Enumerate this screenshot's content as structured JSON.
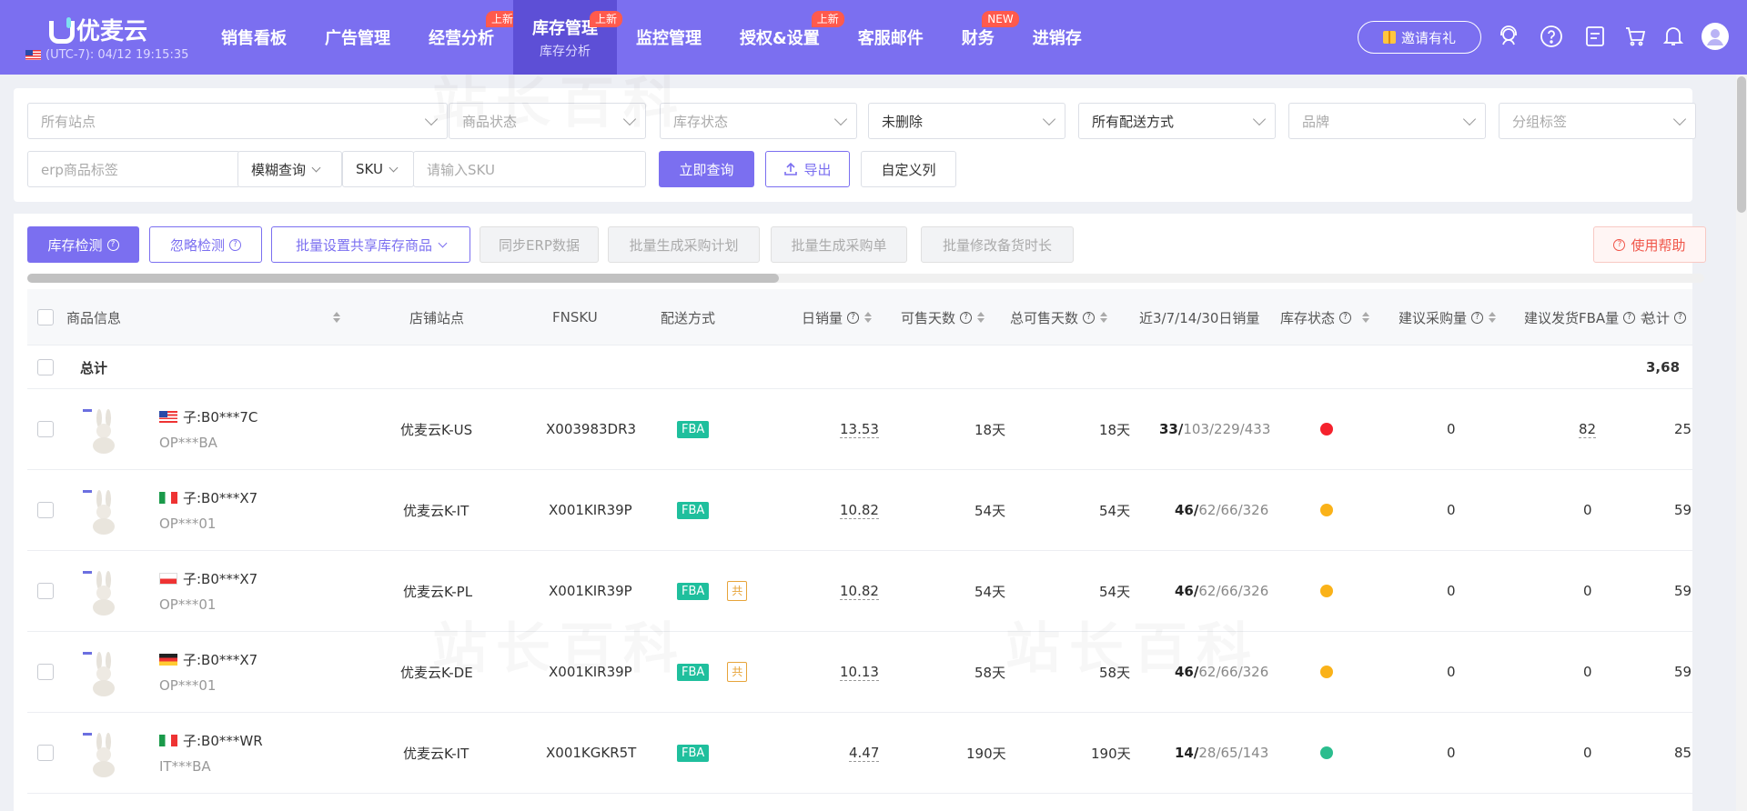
{
  "app": {
    "logo_text": "优麦云",
    "clock": "(UTC-7): 04/12 19:15:35"
  },
  "nav": [
    {
      "label": "销售看板",
      "badge": "",
      "sub": ""
    },
    {
      "label": "广告管理",
      "badge": "",
      "sub": ""
    },
    {
      "label": "经营分析",
      "badge": "上新",
      "sub": ""
    },
    {
      "label": "库存管理",
      "badge": "上新",
      "sub": "库存分析",
      "active": true
    },
    {
      "label": "监控管理",
      "badge": "",
      "sub": ""
    },
    {
      "label": "授权&设置",
      "badge": "上新",
      "sub": ""
    },
    {
      "label": "客服邮件",
      "badge": "",
      "sub": ""
    },
    {
      "label": "财务",
      "badge": "NEW",
      "sub": ""
    },
    {
      "label": "进销存",
      "badge": "",
      "sub": ""
    }
  ],
  "header_right": {
    "invite_label": "邀请有礼",
    "icons": [
      "support-icon",
      "help-icon",
      "message-icon",
      "cart-icon",
      "bell-icon",
      "avatar-icon"
    ]
  },
  "filters": {
    "site": "所有站点",
    "product_status": "商品状态",
    "stock_status": "库存状态",
    "deleted": "未删除",
    "delivery": "所有配送方式",
    "brand": "品牌",
    "group_tag": "分组标签",
    "erp_tag_placeholder": "erp商品标签",
    "match_mode": "模糊查询",
    "field": "SKU",
    "sku_placeholder": "请输入SKU",
    "query_button": "立即查询",
    "export_button": "导出",
    "custom_columns_button": "自定义列"
  },
  "toolbar": {
    "inventory_check": "库存检测",
    "ignore_check": "忽略检测",
    "batch_shared": "批量设置共享库存商品",
    "sync_erp": "同步ERP数据",
    "batch_purchase_plan": "批量生成采购计划",
    "batch_purchase_order": "批量生成采购单",
    "batch_lead_time": "批量修改备货时长",
    "help": "使用帮助"
  },
  "table": {
    "headers": {
      "product_info": "商品信息",
      "store_site": "店铺站点",
      "fnsku": "FNSKU",
      "delivery": "配送方式",
      "daily_sales": "日销量",
      "days_sellable": "可售天数",
      "total_days_sellable": "总可售天数",
      "recent_sales": "近3/7/14/30日销量",
      "stock_status": "库存状态",
      "suggest_purchase": "建议采购量",
      "suggest_fba": "建议发货FBA量",
      "total": "总计"
    },
    "total_row": {
      "label": "总计",
      "total": "3,68"
    },
    "rows": [
      {
        "flag": "us",
        "asin": "子:B0***7C",
        "msku": "OP***BA",
        "store": "优麦云K-US",
        "fnsku": "X003983DR3",
        "delivery": "FBA",
        "shared": "",
        "daily_sales": "13.53",
        "days": "18天",
        "total_days": "18天",
        "s3": "33/",
        "s_rest": "103/229/433",
        "status_color": "#f5222d",
        "purchase": "0",
        "fba": "82",
        "total": "25"
      },
      {
        "flag": "it",
        "asin": "子:B0***X7",
        "msku": "OP***01",
        "store": "优麦云K-IT",
        "fnsku": "X001KIR39P",
        "delivery": "FBA",
        "shared": "",
        "daily_sales": "10.82",
        "days": "54天",
        "total_days": "54天",
        "s3": "46/",
        "s_rest": "62/66/326",
        "status_color": "#fab219",
        "purchase": "0",
        "fba": "0",
        "total": "59"
      },
      {
        "flag": "pl",
        "asin": "子:B0***X7",
        "msku": "OP***01",
        "store": "优麦云K-PL",
        "fnsku": "X001KIR39P",
        "delivery": "FBA",
        "shared": "共",
        "daily_sales": "10.82",
        "days": "54天",
        "total_days": "54天",
        "s3": "46/",
        "s_rest": "62/66/326",
        "status_color": "#fab219",
        "purchase": "0",
        "fba": "0",
        "total": "59"
      },
      {
        "flag": "de",
        "asin": "子:B0***X7",
        "msku": "OP***01",
        "store": "优麦云K-DE",
        "fnsku": "X001KIR39P",
        "delivery": "FBA",
        "shared": "共",
        "daily_sales": "10.13",
        "days": "58天",
        "total_days": "58天",
        "s3": "46/",
        "s_rest": "62/66/326",
        "status_color": "#fab219",
        "purchase": "0",
        "fba": "0",
        "total": "59"
      },
      {
        "flag": "it",
        "asin": "子:B0***WR",
        "msku": "IT***BA",
        "store": "优麦云K-IT",
        "fnsku": "X001KGKR5T",
        "delivery": "FBA",
        "shared": "",
        "daily_sales": "4.47",
        "days": "190天",
        "total_days": "190天",
        "s3": "14/",
        "s_rest": "28/65/143",
        "status_color": "#2bbd8e",
        "purchase": "0",
        "fba": "0",
        "total": "85"
      }
    ]
  }
}
